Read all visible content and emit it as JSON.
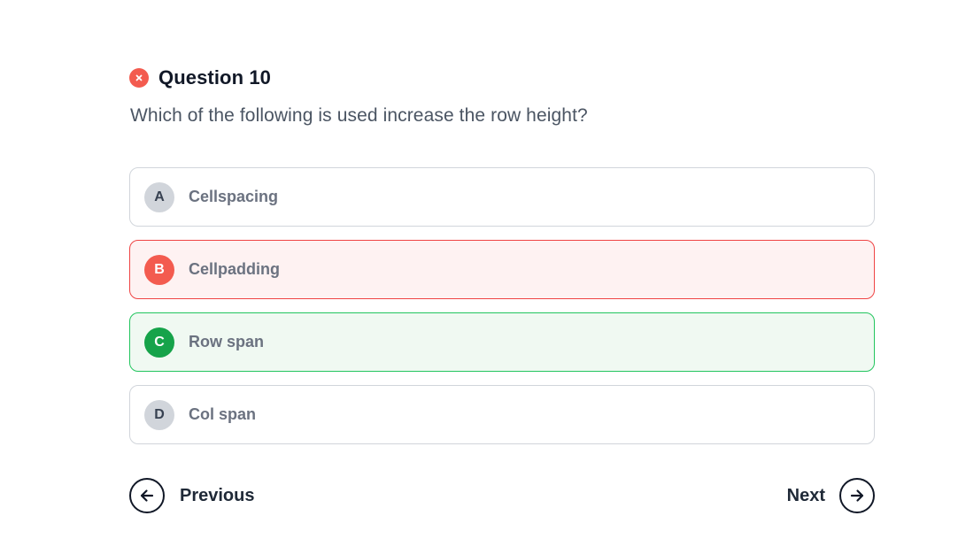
{
  "question": {
    "title": "Question 10",
    "status_icon": "x-circle-icon",
    "status_color": "#f35b4f",
    "text": "Which of the following is used increase the row height?"
  },
  "options": [
    {
      "letter": "A",
      "label": "Cellspacing",
      "state": "neutral"
    },
    {
      "letter": "B",
      "label": "Cellpadding",
      "state": "wrong"
    },
    {
      "letter": "C",
      "label": "Row span",
      "state": "correct"
    },
    {
      "letter": "D",
      "label": "Col span",
      "state": "neutral"
    }
  ],
  "colors": {
    "wrong_border": "#ef4444",
    "wrong_background": "#fef2f2",
    "correct_border": "#22c55e",
    "correct_background": "#f0f9f2"
  },
  "navigation": {
    "previous_label": "Previous",
    "previous_icon": "arrow-left-icon",
    "next_label": "Next",
    "next_icon": "arrow-right-icon"
  }
}
